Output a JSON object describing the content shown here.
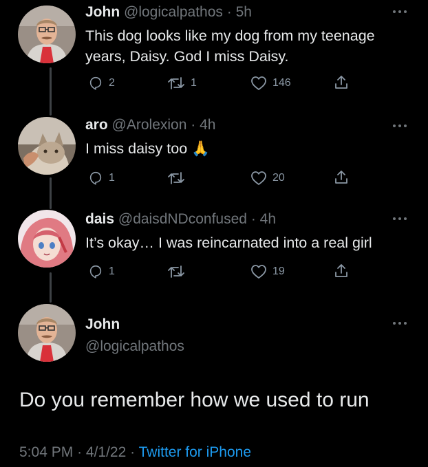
{
  "tweets": [
    {
      "name": "John",
      "handle": "@logicalpathos",
      "separator": "·",
      "time": "5h",
      "lines": [
        "This dog looks like my dog from my teenage",
        "years, Daisy. God I miss Daisy."
      ],
      "replies": "2",
      "retweets": "1",
      "likes": "146"
    },
    {
      "name": "aro",
      "handle": "@Arolexion",
      "separator": "·",
      "time": "4h",
      "lines": [
        "I miss daisy too 🙏"
      ],
      "replies": "1",
      "likes": "20"
    },
    {
      "name": "dais",
      "handle": "@daisdNDconfused",
      "separator": "·",
      "time": "4h",
      "lines": [
        "It’s okay… I was reincarnated into a real girl"
      ],
      "replies": "1",
      "likes": "19"
    }
  ],
  "main_tweet": {
    "name": "John",
    "handle": "@logicalpathos",
    "text": "Do you remember how we used to run",
    "time": "5:04 PM",
    "date": "4/1/22",
    "separator": "·",
    "source": "Twitter for iPhone"
  },
  "colors": {
    "background": "#000000",
    "text": "#e7e9ea",
    "muted": "#71767b",
    "link": "#1d9bf0",
    "thread_line": "#3d4145"
  },
  "icons": [
    "more-icon",
    "reply-icon",
    "retweet-icon",
    "like-icon",
    "share-icon",
    "folded-hands-emoji"
  ]
}
